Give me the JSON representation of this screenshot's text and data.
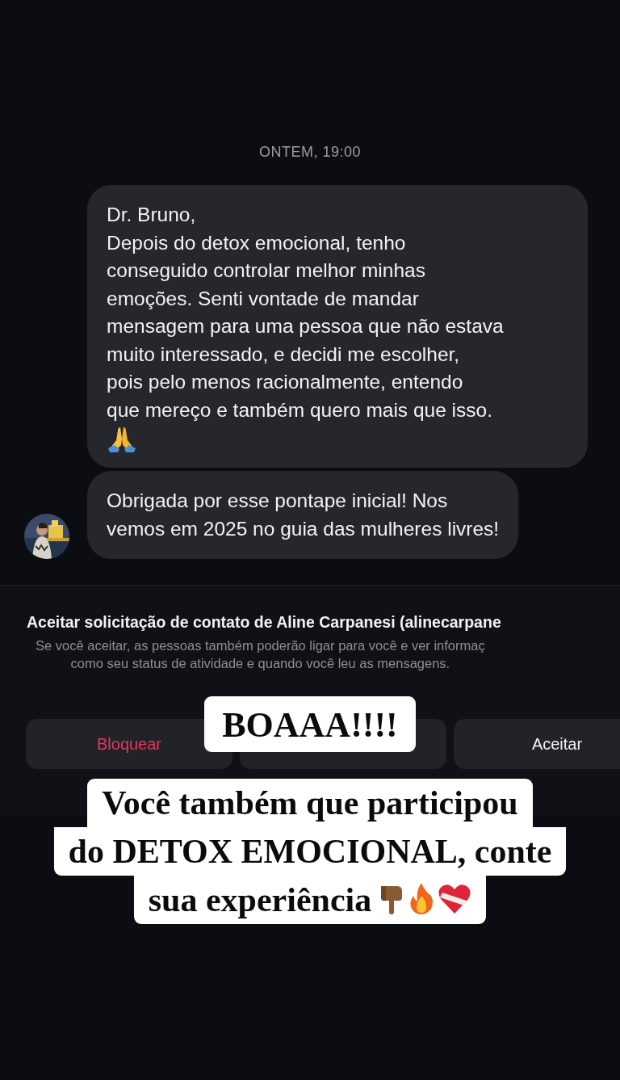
{
  "timestamp": "ONTEM, 19:00",
  "messages": [
    {
      "kind": "text-icon",
      "text": "Dr. Bruno,\nDepois do detox emocional, tenho\nconseguido controlar melhor minhas\nemoções. Senti vontade de mandar\nmensagem para uma pessoa que não estava\nmuito interessado, e decidi me escolher,\npois pelo menos racionalmente, entendo\nque mereço e também quero mais que isso."
    },
    {
      "kind": "text",
      "text": "Obrigada por esse pontape inicial! Nos\nvemos em 2025 no guia das mulheres livres!"
    }
  ],
  "request": {
    "title": "Aceitar solicitação de contato de Aline Carpanesi (alinecarpane",
    "description": "Se você aceitar, as pessoas também poderão ligar para você e ver informaç\ncomo seu status de atividade e quando você leu as mensagens.",
    "buttons": [
      {
        "kind": "danger",
        "label": "Bloquear"
      },
      {
        "kind": "danger"
      },
      {
        "kind": "primary",
        "label": "Aceitar"
      }
    ]
  },
  "stickers": [
    {
      "kind": "short",
      "text": "BOAAA!!!!"
    },
    {
      "kind": "long",
      "lines": [
        "Você também que participou",
        "do DETOX EMOCIONAL, conte",
        "sua experiência"
      ]
    }
  ]
}
